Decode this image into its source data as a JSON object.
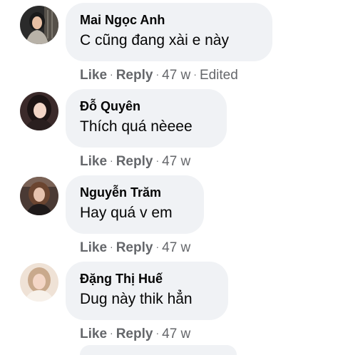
{
  "comments": [
    {
      "author": "Mai Ngọc Anh",
      "text": "C cũng đang xài e này",
      "like_label": "Like",
      "reply_label": "Reply",
      "time": "47 w",
      "edited": "Edited",
      "avatar_colors": {
        "bg": "#2a2a2a",
        "skin": "#e8c0a4",
        "hair": "#1a1a1a",
        "cloth": "#b8b2a8"
      }
    },
    {
      "author": "Đỗ Quyên",
      "text": "Thích quá nèeee",
      "like_label": "Like",
      "reply_label": "Reply",
      "time": "47 w",
      "avatar_colors": {
        "bg": "#3b2a2a",
        "skin": "#f1d5c6",
        "hair": "#1c1414",
        "cloth": "#2a1f1f"
      }
    },
    {
      "author": "Nguyễn Trăm",
      "text": "Hay quá v em",
      "like_label": "Like",
      "reply_label": "Reply",
      "time": "47 w",
      "avatar_colors": {
        "bg": "#4a3a34",
        "skin": "#e6c2ad",
        "hair": "#6b4530",
        "cloth": "#1e1a1a"
      }
    },
    {
      "author": "Đặng Thị Huế",
      "text": "Dug này thik hẳn",
      "like_label": "Like",
      "reply_label": "Reply",
      "time": "47 w",
      "avatar_colors": {
        "bg": "#efe2d6",
        "skin": "#f4d6c6",
        "hair": "#c9a98c",
        "cloth": "#f7f1ea"
      }
    }
  ],
  "colors": {
    "bubble_bg": "#f0f2f5",
    "action_text": "#65676b",
    "primary_text": "#050505"
  }
}
